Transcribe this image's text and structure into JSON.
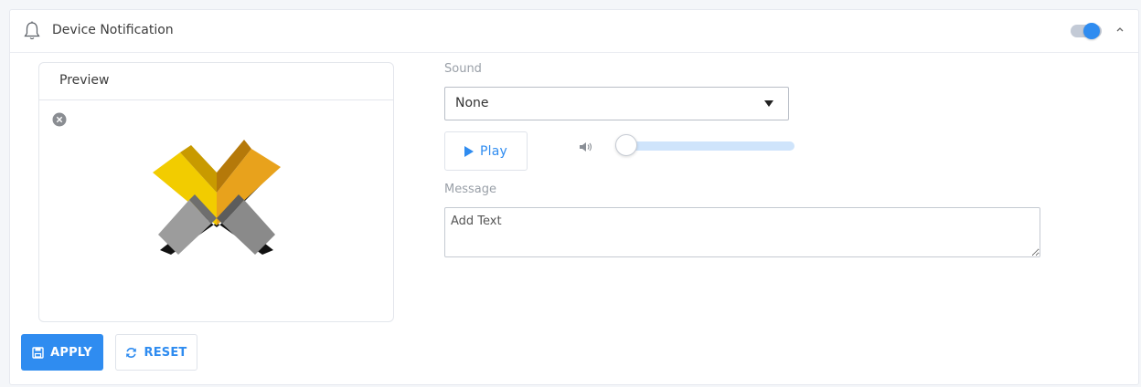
{
  "header": {
    "title": "Device Notification",
    "icon": "bell-icon",
    "toggle_on": true,
    "collapse_icon": "chevron-up-icon"
  },
  "preview": {
    "title": "Preview",
    "close_icon": "close-circle-icon",
    "logo_icon": "x-logo-icon"
  },
  "sound": {
    "label": "Sound",
    "selected": "None",
    "play_label": "Play",
    "volume_icon": "volume-icon",
    "volume_level": 0.0
  },
  "message": {
    "label": "Message",
    "placeholder": "Add Text",
    "value": ""
  },
  "actions": {
    "apply_label": "APPLY",
    "reset_label": "RESET"
  },
  "colors": {
    "accent": "#2f8cf0",
    "logo_gold": "#e8b400",
    "logo_gray": "#9a9a9a"
  }
}
